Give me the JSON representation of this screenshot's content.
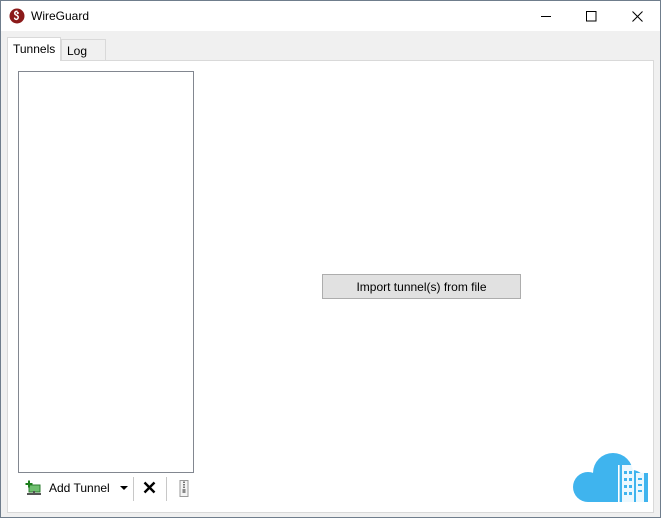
{
  "window": {
    "title": "WireGuard",
    "controls": {
      "minimize": "minimize-icon",
      "maximize": "maximize-icon",
      "close": "close-icon"
    }
  },
  "tabs": [
    {
      "label": "Tunnels",
      "active": true
    },
    {
      "label": "Log",
      "active": false
    }
  ],
  "main": {
    "import_button_label": "Import tunnel(s) from file"
  },
  "toolbar": {
    "add_tunnel_label": "Add Tunnel",
    "icons": [
      "add-tunnel-icon",
      "dropdown-arrow-icon",
      "delete-icon",
      "export-zip-icon"
    ]
  },
  "colors": {
    "brand_red": "#8b1a1a",
    "cloud_blue": "#3fb4ee",
    "add_green": "#3aa63a"
  }
}
